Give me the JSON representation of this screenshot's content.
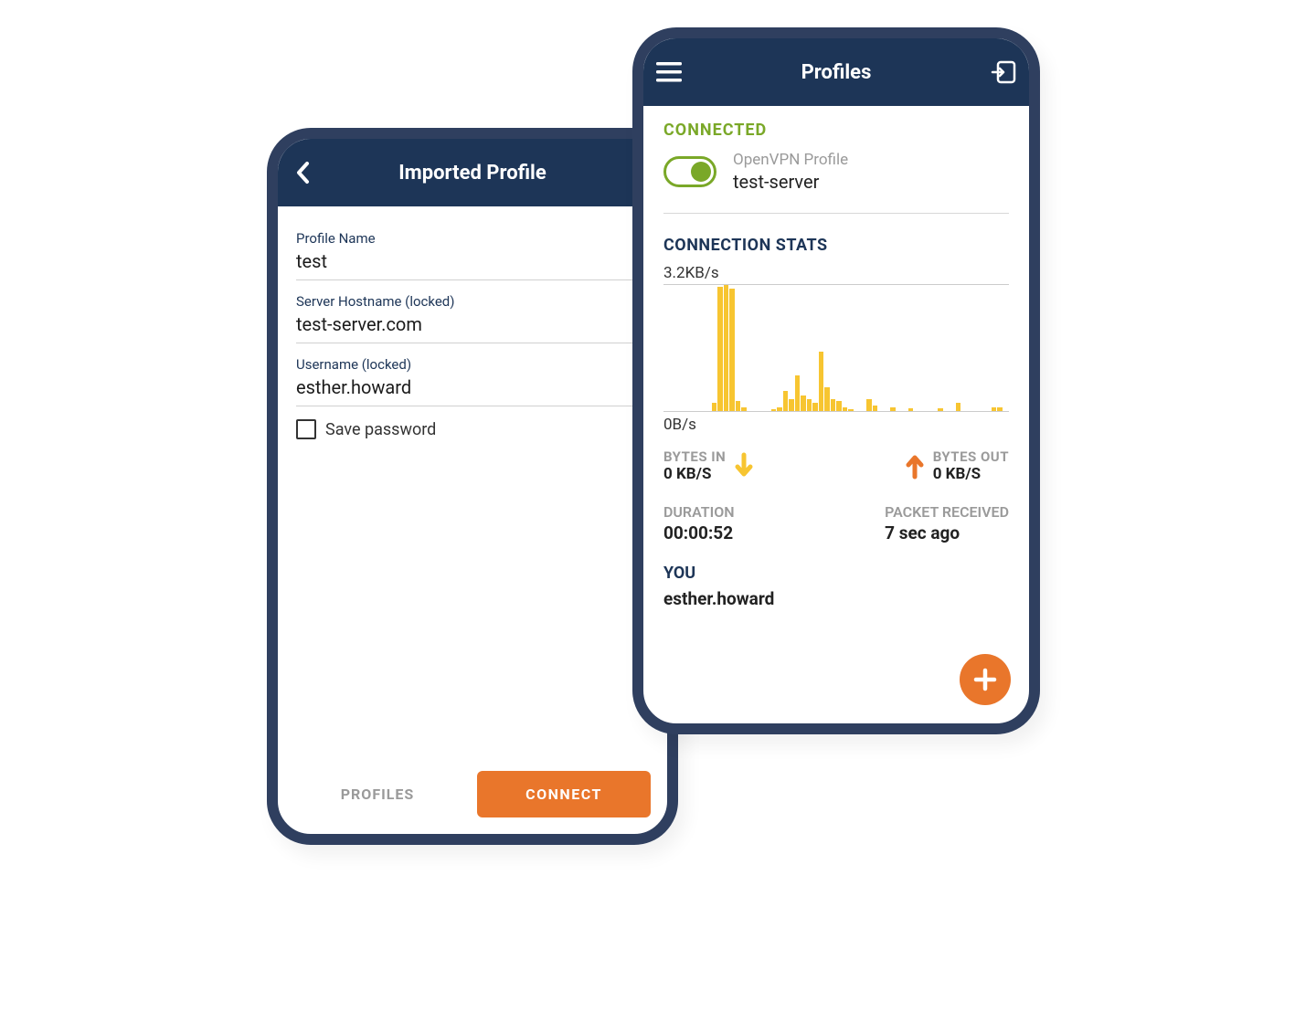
{
  "left": {
    "title": "Imported Profile",
    "profile_name_label": "Profile Name",
    "profile_name_value": "test",
    "hostname_label": "Server Hostname (locked)",
    "hostname_value": "test-server.com",
    "username_label": "Username (locked)",
    "username_value": "esther.howard",
    "save_password_label": "Save password",
    "profiles_button": "PROFILES",
    "connect_button": "CONNECT"
  },
  "right": {
    "title": "Profiles",
    "connected_label": "CONNECTED",
    "profile_type": "OpenVPN Profile",
    "profile_name": "test-server",
    "stats_title": "CONNECTION STATS",
    "y_max": "3.2KB/s",
    "y_min": "0B/s",
    "bytes_in_label": "BYTES IN",
    "bytes_in_value": "0 KB/S",
    "bytes_out_label": "BYTES OUT",
    "bytes_out_value": "0 KB/S",
    "duration_label": "DURATION",
    "duration_value": "00:00:52",
    "packet_label": "PACKET RECEIVED",
    "packet_value": "7 sec ago",
    "you_label": "YOU",
    "you_value": "esther.howard"
  },
  "chart_data": {
    "type": "area",
    "ylabel": "",
    "xlabel": "",
    "ylim": [
      0,
      3.2
    ],
    "y_unit": "KB/s",
    "values": [
      0,
      0,
      0,
      0,
      0,
      0,
      0,
      0,
      0.2,
      3.15,
      3.2,
      3.1,
      0.25,
      0.1,
      0,
      0,
      0,
      0,
      0.05,
      0.1,
      0.5,
      0.3,
      0.9,
      0.4,
      0.3,
      0.2,
      1.5,
      0.6,
      0.3,
      0.25,
      0.1,
      0.05,
      0,
      0,
      0.3,
      0.15,
      0,
      0,
      0.1,
      0,
      0,
      0.08,
      0,
      0,
      0,
      0,
      0.06,
      0,
      0,
      0.2,
      0,
      0,
      0,
      0,
      0,
      0.1,
      0.1,
      0
    ],
    "title": "CONNECTION STATS"
  },
  "colors": {
    "navy": "#1d3557",
    "orange": "#e9762b",
    "green": "#7aa828",
    "yellow": "#f7c531"
  }
}
